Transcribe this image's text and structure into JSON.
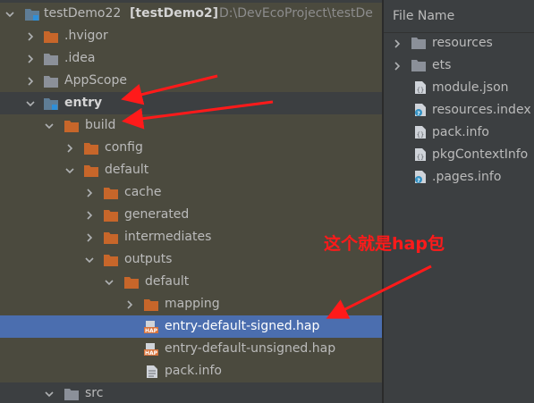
{
  "project_tree": {
    "root": {
      "name": "testDemo22",
      "module": "[testDemo2]",
      "path": "D:\\DevEcoProject\\testDe"
    },
    "items": [
      {
        "label": ".hvigor"
      },
      {
        "label": ".idea"
      },
      {
        "label": "AppScope"
      },
      {
        "label": "entry"
      },
      {
        "label": "build"
      },
      {
        "label": "config"
      },
      {
        "label": "default"
      },
      {
        "label": "cache"
      },
      {
        "label": "generated"
      },
      {
        "label": "intermediates"
      },
      {
        "label": "outputs"
      },
      {
        "label": "default"
      },
      {
        "label": "mapping"
      },
      {
        "label": "entry-default-signed.hap"
      },
      {
        "label": "entry-default-unsigned.hap"
      },
      {
        "label": "pack.info"
      },
      {
        "label": "src"
      }
    ]
  },
  "file_panel": {
    "header": "File Name",
    "items": [
      {
        "label": "resources"
      },
      {
        "label": "ets"
      },
      {
        "label": "module.json"
      },
      {
        "label": "resources.index"
      },
      {
        "label": "pack.info"
      },
      {
        "label": "pkgContextInfo"
      },
      {
        "label": ".pages.info"
      }
    ]
  },
  "annotation": {
    "text": "这个就是hap包",
    "color": "#ff1a1a"
  },
  "colors": {
    "panel_bg": "#3c3f41",
    "selection": "#4b6eaf",
    "folder": "#c7662a",
    "module_folder": "#5f7d96",
    "hap_badge": "#d8733c",
    "arrow": "#ff1a1a"
  }
}
